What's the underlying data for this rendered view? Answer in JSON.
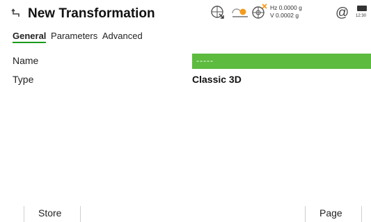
{
  "header": {
    "title": "New Transformation",
    "hz_line": "Hz 0.0000 g",
    "v_line": "V  0.0002 g",
    "at_symbol": "@",
    "battery_time": "12:30"
  },
  "tabs": [
    {
      "label": "General",
      "active": true
    },
    {
      "label": "Parameters",
      "active": false
    },
    {
      "label": "Advanced",
      "active": false
    }
  ],
  "fields": {
    "name_label": "Name",
    "name_value": "-----",
    "type_label": "Type",
    "type_value": "Classic 3D"
  },
  "footer": {
    "store_label": "Store",
    "page_label": "Page"
  },
  "colors": {
    "accent": "#1b9a1b",
    "field_highlight": "#5dbb3f",
    "orange": "#f59b1c"
  },
  "icons": [
    "back-arrow-icon",
    "target-arrow-icon",
    "prism-icon",
    "crosshair-warning-icon",
    "at-icon",
    "battery-icon"
  ]
}
